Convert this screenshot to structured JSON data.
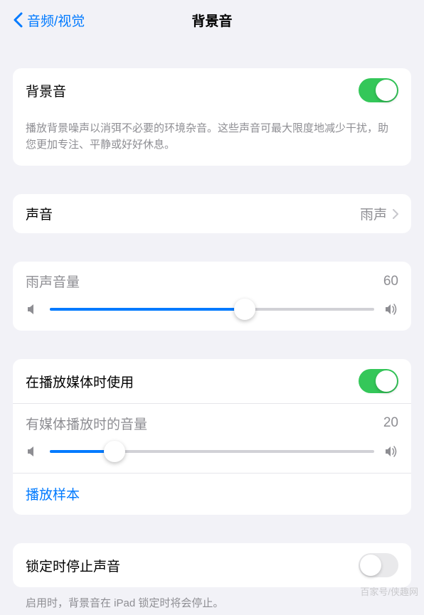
{
  "header": {
    "back_label": "音频/视觉",
    "title": "背景音"
  },
  "main_toggle": {
    "label": "背景音",
    "on": true,
    "description": "播放背景噪声以消弭不必要的环境杂音。这些声音可最大限度地减少干扰，助您更加专注、平静或好好休息。"
  },
  "sound": {
    "label": "声音",
    "value": "雨声"
  },
  "volume": {
    "label": "雨声音量",
    "value": "60",
    "percent": 60
  },
  "media": {
    "use_label": "在播放媒体时使用",
    "use_on": true,
    "volume_label": "有媒体播放时的音量",
    "volume_value": "20",
    "volume_percent": 20,
    "sample_label": "播放样本"
  },
  "lock": {
    "label": "锁定时停止声音",
    "on": false,
    "description": "启用时，背景音在 iPad 锁定时将会停止。"
  },
  "watermark": "百家号/侠趣网"
}
